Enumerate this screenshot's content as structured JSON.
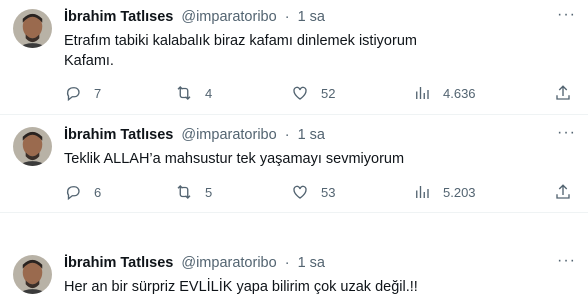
{
  "tweets": [
    {
      "name": "İbrahim Tatlıses",
      "handle": "@imparatoribo",
      "sep": "·",
      "time": "1 sa",
      "more": "···",
      "lines": [
        "Etrafım tabiki kalabalık biraz kafamı dinlemek istiyorum",
        "Kafamı."
      ],
      "replies": "7",
      "retweets": "4",
      "likes": "52",
      "views": "4.636"
    },
    {
      "name": "İbrahim Tatlıses",
      "handle": "@imparatoribo",
      "sep": "·",
      "time": "1 sa",
      "more": "···",
      "lines": [
        "Teklik ALLAH’a mahsustur tek yaşamayı sevmiyorum"
      ],
      "replies": "6",
      "retweets": "5",
      "likes": "53",
      "views": "5.203"
    },
    {
      "name": "İbrahim Tatlıses",
      "handle": "@imparatoribo",
      "sep": "·",
      "time": "1 sa",
      "more": "···",
      "lines": [
        "Her an bir sürpriz  EVLİLİK yapa bilirim çok uzak değil.!!"
      ]
    }
  ],
  "icons": {
    "reply": "reply-icon",
    "retweet": "retweet-icon",
    "like": "heart-icon",
    "views": "views-icon",
    "share": "share-icon",
    "more": "more-icon"
  },
  "colors": {
    "text": "#0f1419",
    "secondary": "#536471",
    "divider": "#eff3f4"
  }
}
